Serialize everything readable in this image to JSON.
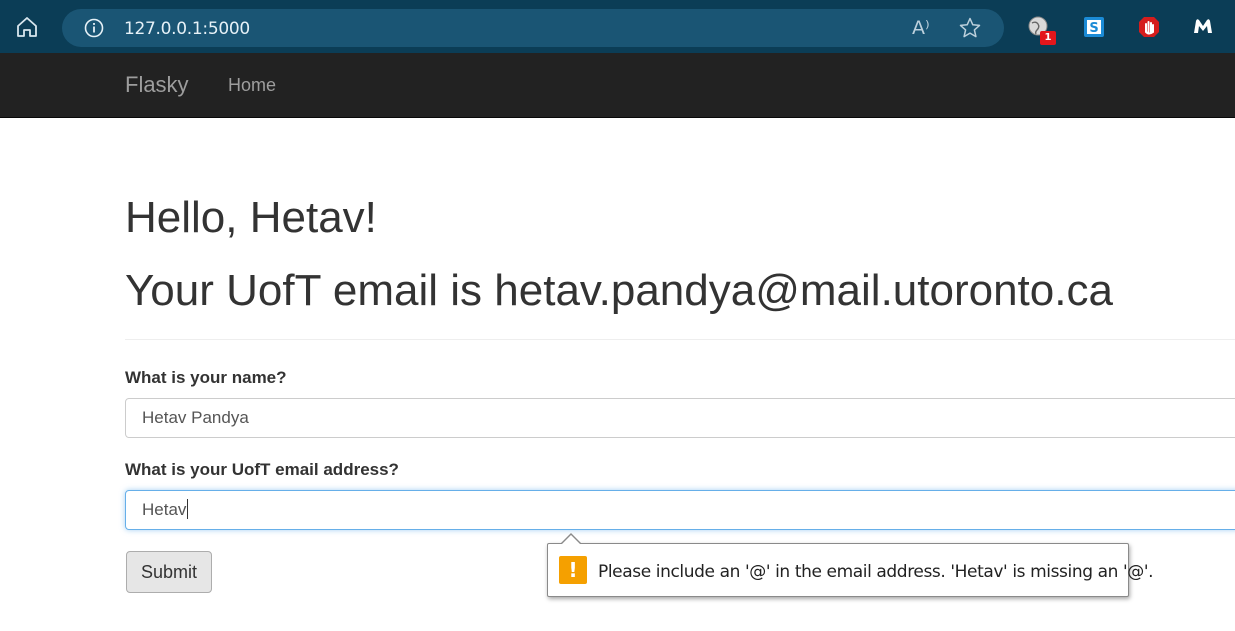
{
  "browser": {
    "url": "127.0.0.1:5000",
    "read_aloud_glyph": "A⁾",
    "extension_badge": "1",
    "accent": "#0b3d56"
  },
  "navbar": {
    "brand": "Flasky",
    "links": [
      "Home"
    ]
  },
  "page": {
    "greeting": "Hello, Hetav!",
    "email_line": "Your UofT email is hetav.pandya@mail.utoronto.ca"
  },
  "form": {
    "name_label": "What is your name?",
    "name_value": "Hetav Pandya",
    "email_label": "What is your UofT email address?",
    "email_value": "Hetav",
    "submit_label": "Submit"
  },
  "validation": {
    "icon": "!",
    "message": "Please include an '@' in the email address. 'Hetav' is missing an '@'.",
    "icon_color": "#f5a000"
  }
}
